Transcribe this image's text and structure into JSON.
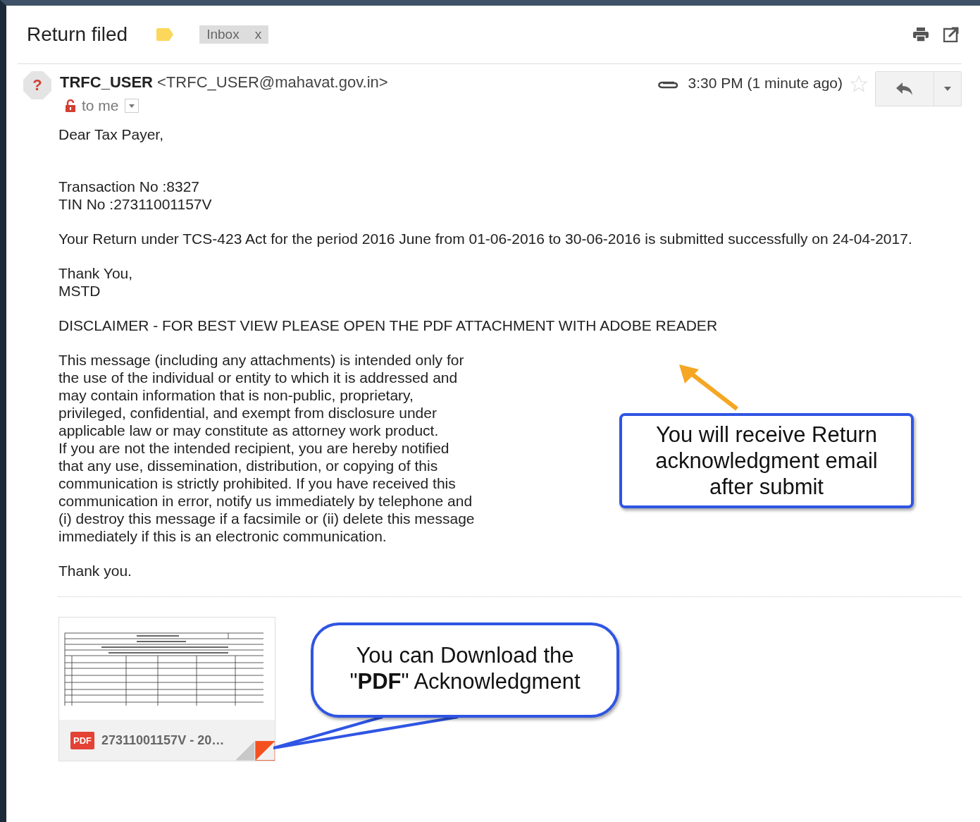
{
  "subject": "Return filed",
  "labels": [
    {
      "text": "Inbox",
      "remove": "x"
    }
  ],
  "sender": {
    "avatar": "?",
    "name": "TRFC_USER",
    "email": "<TRFC_USER@mahavat.gov.in>",
    "recipient": "to me",
    "time": "3:30 PM (1 minute ago)",
    "starred": false
  },
  "body": [
    {
      "kind": "lines",
      "lines": [
        "Dear Tax Payer,"
      ]
    },
    {
      "kind": "gap"
    },
    {
      "kind": "lines",
      "lines": [
        "Transaction No :8327",
        "TIN No :27311001157V"
      ]
    },
    {
      "kind": "para",
      "text": "Your Return under TCS-423 Act for the period 2016 June from 01-06-2016 to 30-06-2016 is submitted successfully on 24-04-2017."
    },
    {
      "kind": "lines",
      "lines": [
        "Thank You,",
        "MSTD"
      ]
    },
    {
      "kind": "lines",
      "lines": [
        "DISCLAIMER - FOR BEST VIEW PLEASE OPEN THE PDF ATTACHMENT WITH ADOBE READER"
      ]
    },
    {
      "kind": "narrow",
      "lines": [
        "This message (including any attachments) is intended only for",
        "the use of the individual or entity to which it is addressed and",
        "may contain information that is non-public, proprietary,",
        "privileged, confidential, and exempt from disclosure under",
        "applicable law or may constitute as attorney work product.",
        "If you are not the intended recipient, you are hereby notified",
        "that any use, dissemination, distribution, or copying of this",
        "communication is strictly prohibited. If you have received this",
        "communication in error, notify us immediately by telephone and",
        "(i) destroy this message if a facsimile or (ii) delete this message",
        "immediately if this is an electronic communication."
      ]
    },
    {
      "kind": "lines",
      "lines": [
        "Thank you."
      ]
    }
  ],
  "attachment": {
    "type_badge": "PDF",
    "name": "27311001157V - 20…"
  },
  "callouts": [
    {
      "lines": [
        "You will receive Return",
        "acknowledgment email",
        "after submit"
      ]
    },
    {
      "lines": [
        "You can Download the",
        "\"**PDF**\" Acknowledgment"
      ]
    }
  ]
}
